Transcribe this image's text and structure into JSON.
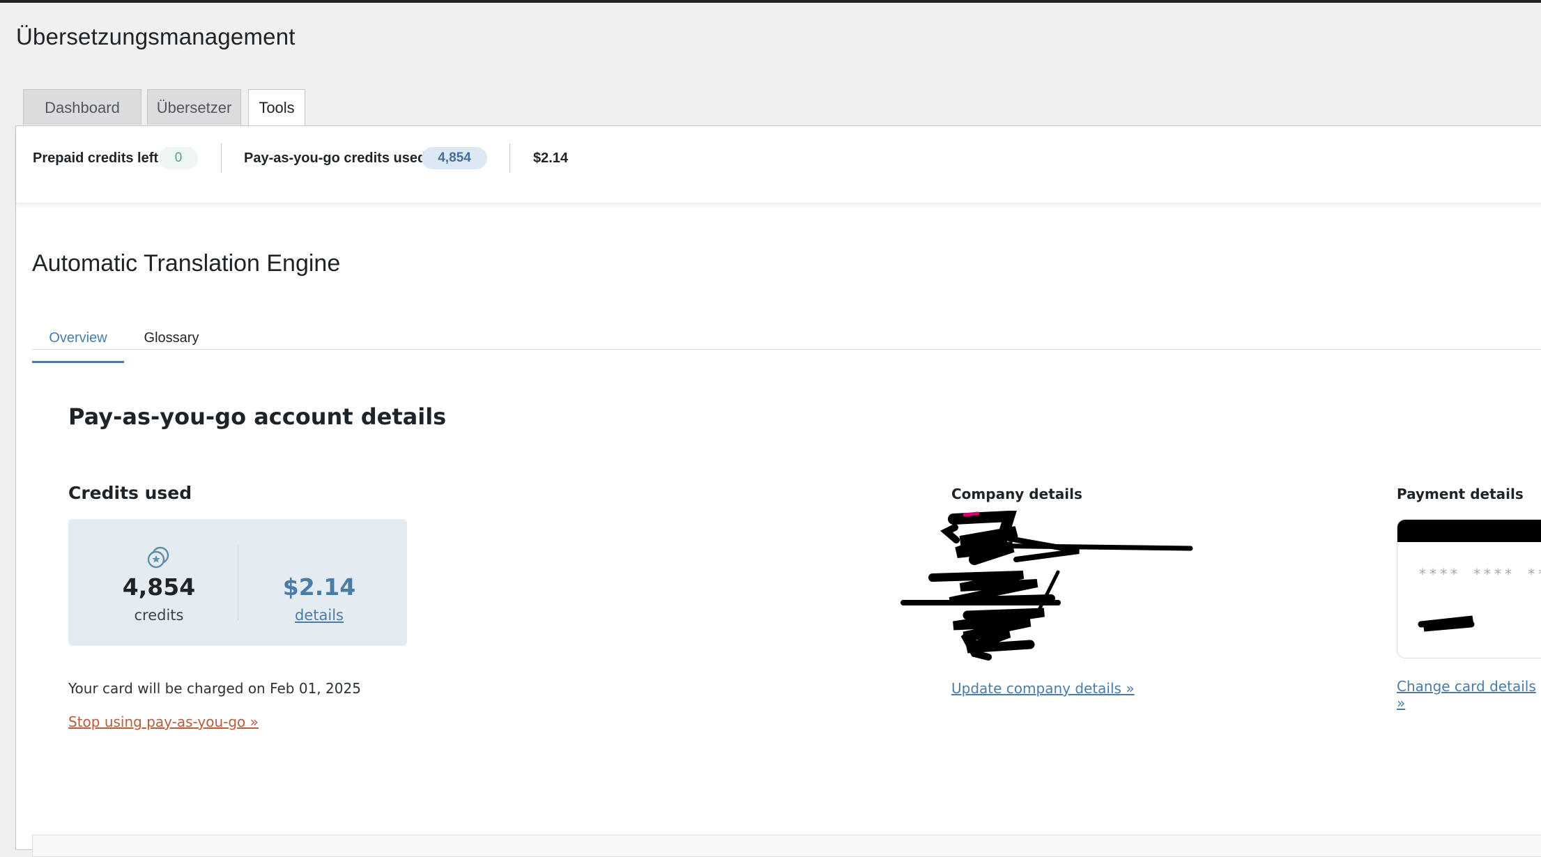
{
  "page": {
    "title": "Übersetzungsmanagement"
  },
  "nav_tabs": [
    {
      "label": "Dashboard",
      "active": false
    },
    {
      "label": "Übersetzer",
      "active": false
    },
    {
      "label": "Tools",
      "active": true
    }
  ],
  "credits_bar": {
    "prepaid_label": "Prepaid credits left",
    "prepaid_value": "0",
    "payg_label": "Pay-as-you-go credits used",
    "payg_value": "4,854",
    "amount": "$2.14"
  },
  "section": {
    "title": "Automatic Translation Engine",
    "tabs": [
      {
        "label": "Overview",
        "active": true
      },
      {
        "label": "Glossary",
        "active": false
      }
    ]
  },
  "account": {
    "title": "Pay-as-you-go account details",
    "credits_used_heading": "Credits used",
    "credits_value": "4,854",
    "credits_unit": "credits",
    "cost_value": "$2.14",
    "details_link": "details",
    "charge_text": "Your card will be charged on Feb 01, 2025",
    "stop_link": "Stop using pay-as-you-go »"
  },
  "company": {
    "heading": "Company details",
    "update_link": "Update company details »"
  },
  "payment": {
    "heading": "Payment details",
    "card_mask": [
      "****",
      "****",
      "**"
    ],
    "change_link": "Change card details »"
  },
  "icons": {
    "credits": "coins-icon"
  },
  "colors": {
    "accent_blue": "#4a7ca7",
    "stop_link": "#b65c3f",
    "usage_box": "#e4ebf1"
  }
}
